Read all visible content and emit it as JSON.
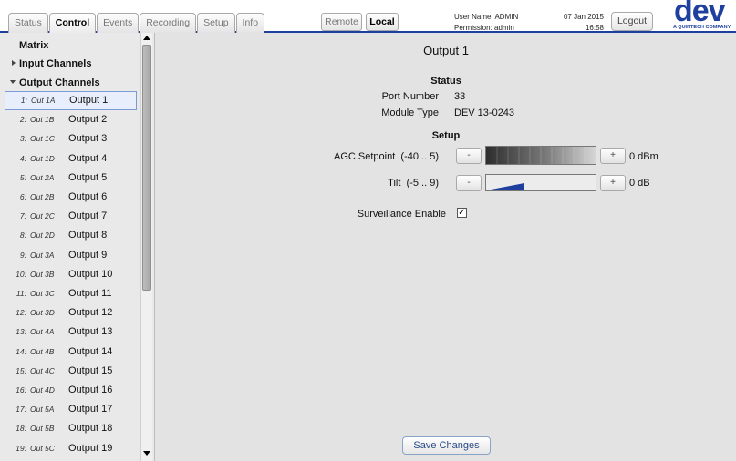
{
  "tabs": [
    {
      "label": "Status",
      "active": false
    },
    {
      "label": "Control",
      "active": true
    },
    {
      "label": "Events",
      "active": false
    },
    {
      "label": "Recording",
      "active": false
    },
    {
      "label": "Setup",
      "active": false
    },
    {
      "label": "Info",
      "active": false
    }
  ],
  "mode": {
    "remote": "Remote",
    "local": "Local",
    "selected": "Local"
  },
  "user": {
    "name_line": "User Name: ADMIN",
    "permission_line": "Permission: admin"
  },
  "datetime": {
    "date": "07 Jan 2015",
    "time": "16:58"
  },
  "logout_label": "Logout",
  "logo": {
    "text": "dev",
    "tagline": "A QUINTECH COMPANY"
  },
  "sidebar": {
    "matrix": "Matrix",
    "input_channels": "Input Channels",
    "output_channels": "Output Channels",
    "channels": [
      {
        "num": "1:",
        "code": "Out 1A",
        "name": "Output 1"
      },
      {
        "num": "2:",
        "code": "Out 1B",
        "name": "Output 2"
      },
      {
        "num": "3:",
        "code": "Out 1C",
        "name": "Output 3"
      },
      {
        "num": "4:",
        "code": "Out 1D",
        "name": "Output 4"
      },
      {
        "num": "5:",
        "code": "Out 2A",
        "name": "Output 5"
      },
      {
        "num": "6:",
        "code": "Out 2B",
        "name": "Output 6"
      },
      {
        "num": "7:",
        "code": "Out 2C",
        "name": "Output 7"
      },
      {
        "num": "8:",
        "code": "Out 2D",
        "name": "Output 8"
      },
      {
        "num": "9:",
        "code": "Out 3A",
        "name": "Output 9"
      },
      {
        "num": "10:",
        "code": "Out 3B",
        "name": "Output 10"
      },
      {
        "num": "11:",
        "code": "Out 3C",
        "name": "Output 11"
      },
      {
        "num": "12:",
        "code": "Out 3D",
        "name": "Output 12"
      },
      {
        "num": "13:",
        "code": "Out 4A",
        "name": "Output 13"
      },
      {
        "num": "14:",
        "code": "Out 4B",
        "name": "Output 14"
      },
      {
        "num": "15:",
        "code": "Out 4C",
        "name": "Output 15"
      },
      {
        "num": "16:",
        "code": "Out 4D",
        "name": "Output 16"
      },
      {
        "num": "17:",
        "code": "Out 5A",
        "name": "Output 17"
      },
      {
        "num": "18:",
        "code": "Out 5B",
        "name": "Output 18"
      },
      {
        "num": "19:",
        "code": "Out 5C",
        "name": "Output 19"
      }
    ],
    "selected_index": 0
  },
  "main": {
    "title": "Output 1",
    "status_heading": "Status",
    "port_number_label": "Port Number",
    "port_number_value": "33",
    "module_type_label": "Module Type",
    "module_type_value": "DEV 13-0243",
    "setup_heading": "Setup",
    "agc_label": "AGC Setpoint",
    "agc_range": "(-40 .. 5)",
    "agc_minus": "-",
    "agc_plus": "+",
    "agc_value": "0 dBm",
    "tilt_label": "Tilt",
    "tilt_range": "(-5 .. 9)",
    "tilt_minus": "-",
    "tilt_plus": "+",
    "tilt_value": "0 dB",
    "surveillance_label": "Surveillance Enable",
    "surveillance_checked": true,
    "checkmark": "✓",
    "save_label": "Save Changes"
  },
  "colors": {
    "accent": "#1f3f9e",
    "tilt_fill": "#1f3f9e"
  }
}
